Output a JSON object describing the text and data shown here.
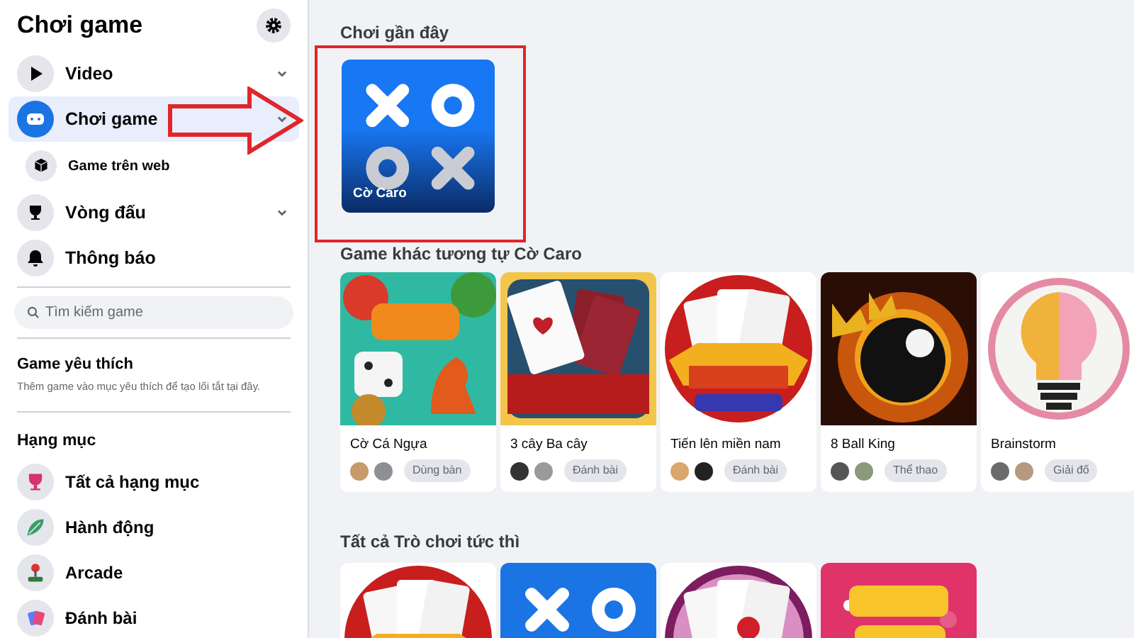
{
  "sidebar": {
    "title": "Chơi game",
    "nav_items": [
      {
        "label": "Video",
        "selected": false,
        "expandable": true
      },
      {
        "label": "Chơi game",
        "selected": true,
        "expandable": true,
        "children": [
          {
            "label": "Game trên web",
            "selected": false
          }
        ]
      },
      {
        "label": "Vòng đấu",
        "selected": false,
        "expandable": true
      },
      {
        "label": "Thông báo",
        "selected": false,
        "expandable": false
      }
    ],
    "search": {
      "placeholder": "Tìm kiếm game"
    },
    "favorites": {
      "title": "Game yêu thích",
      "description": "Thêm game vào mục yêu thích để tạo lối tắt tại đây."
    },
    "categories": {
      "title": "Hạng mục",
      "items": [
        "Tất cả hạng mục",
        "Hành động",
        "Arcade",
        "Đánh bài"
      ]
    }
  },
  "recent": {
    "title": "Chơi gần đây",
    "games": [
      {
        "title": "Cờ Caro",
        "kind": "caro"
      }
    ]
  },
  "similar": {
    "title": "Game khác tương tự Cờ Caro",
    "games": [
      {
        "title": "Cờ Cá Ngựa",
        "tag": "Dùng bàn"
      },
      {
        "title": "3 cây Ba cây",
        "tag": "Đánh bài"
      },
      {
        "title": "Tiến lên miền nam",
        "tag": "Đánh bài"
      },
      {
        "title": "8 Ball King",
        "tag": "Thể thao"
      },
      {
        "title": "Brainstorm",
        "tag": "Giải đố"
      }
    ]
  },
  "all_games": {
    "title": "Tất cả Trò chơi tức thì",
    "games": [
      {
        "kind": "picture"
      },
      {
        "kind": "caro"
      },
      {
        "kind": "picture"
      },
      {
        "kind": "picture"
      }
    ]
  }
}
